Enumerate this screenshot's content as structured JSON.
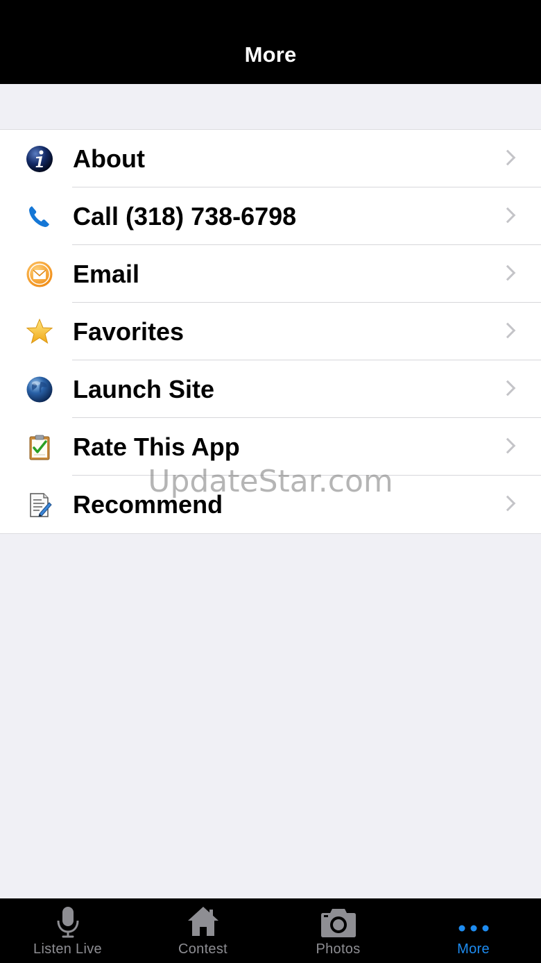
{
  "header": {
    "title": "More"
  },
  "menu": {
    "items": [
      {
        "label": "About",
        "icon": "info-icon"
      },
      {
        "label": "Call (318) 738-6798",
        "icon": "phone-icon"
      },
      {
        "label": "Email",
        "icon": "envelope-icon"
      },
      {
        "label": "Favorites",
        "icon": "star-icon"
      },
      {
        "label": "Launch Site",
        "icon": "globe-icon"
      },
      {
        "label": "Rate This App",
        "icon": "clipboard-check-icon"
      },
      {
        "label": "Recommend",
        "icon": "document-pen-icon"
      }
    ]
  },
  "watermark": "UpdateStar.com",
  "tabs": [
    {
      "label": "Listen Live",
      "icon": "microphone-icon",
      "active": false
    },
    {
      "label": "Contest",
      "icon": "house-icon",
      "active": false
    },
    {
      "label": "Photos",
      "icon": "camera-icon",
      "active": false
    },
    {
      "label": "More",
      "icon": "more-dots-icon",
      "active": true
    }
  ],
  "colors": {
    "nav_background": "#000000",
    "tab_active": "#1e8cf0",
    "tab_inactive": "#8e8e93",
    "page_background": "#f0f0f5"
  }
}
